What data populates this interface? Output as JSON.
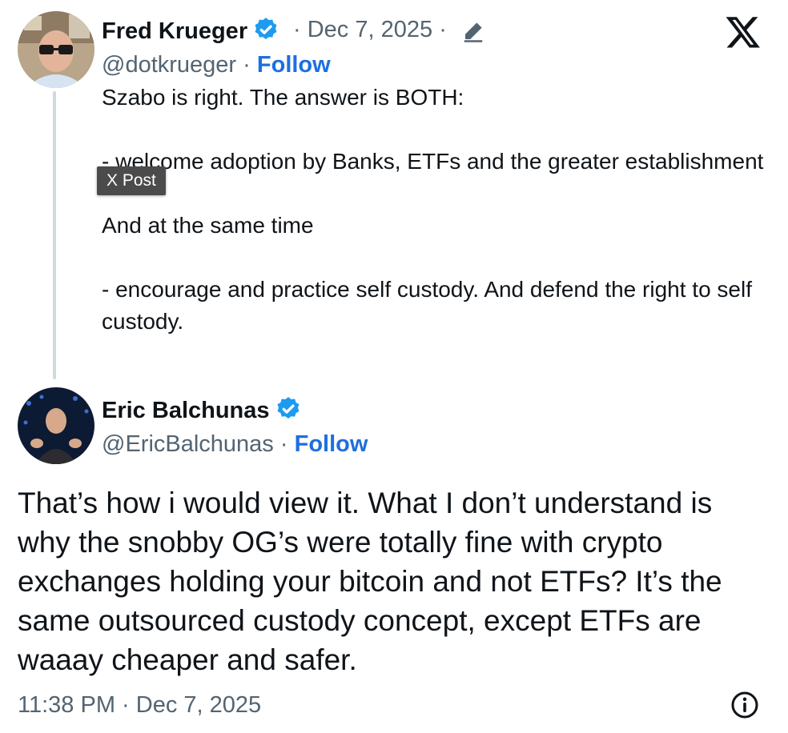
{
  "quoted_post": {
    "author_name": "Fred Krueger",
    "handle": "@dotkrueger",
    "date": "Dec 7, 2025",
    "follow_label": "Follow",
    "text": "Szabo is right. The answer is BOTH:\n\n- welcome adoption by Banks, ETFs and the greater establishment\n\nAnd at the same time\n\n- encourage and practice self custody. And defend the right to self custody."
  },
  "tooltip": {
    "label": "X Post"
  },
  "main_post": {
    "author_name": "Eric Balchunas",
    "handle": "@EricBalchunas",
    "follow_label": "Follow",
    "text": "That’s how i would view it. What I don’t understand is why the snobby OG’s were totally fine with crypto exchanges holding your bitcoin and not ETFs? It’s the same outsourced custody concept, except ETFs are waaay cheaper and safer.",
    "timestamp": "11:38 PM · Dec 7, 2025"
  },
  "separators": {
    "dot": "·"
  },
  "colors": {
    "verified": "#1d9bf0",
    "follow": "#1d6fe0",
    "muted": "#536471",
    "thread_line": "#cfd9de"
  },
  "icons": [
    "verified-badge-icon",
    "edit-pencil-icon",
    "x-logo-icon",
    "info-icon"
  ]
}
